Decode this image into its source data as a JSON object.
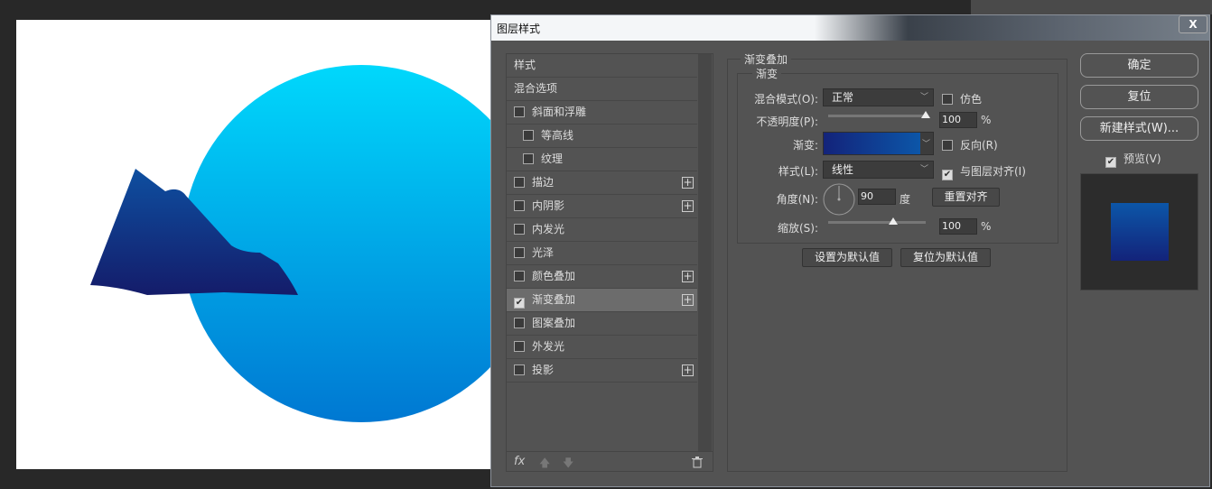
{
  "dialog": {
    "title": "图层样式",
    "close_label": "X"
  },
  "styles_list": {
    "items": [
      {
        "label": "样式",
        "checkbox": false
      },
      {
        "label": "混合选项",
        "checkbox": false
      },
      {
        "label": "斜面和浮雕",
        "checkbox": true,
        "checked": false
      },
      {
        "label": "等高线",
        "checkbox": true,
        "checked": false,
        "indent": true
      },
      {
        "label": "纹理",
        "checkbox": true,
        "checked": false,
        "indent": true
      },
      {
        "label": "描边",
        "checkbox": true,
        "checked": false,
        "plus": true
      },
      {
        "label": "内阴影",
        "checkbox": true,
        "checked": false,
        "plus": true
      },
      {
        "label": "内发光",
        "checkbox": true,
        "checked": false
      },
      {
        "label": "光泽",
        "checkbox": true,
        "checked": false
      },
      {
        "label": "颜色叠加",
        "checkbox": true,
        "checked": false,
        "plus": true
      },
      {
        "label": "渐变叠加",
        "checkbox": true,
        "checked": true,
        "plus": true,
        "selected": true
      },
      {
        "label": "图案叠加",
        "checkbox": true,
        "checked": false
      },
      {
        "label": "外发光",
        "checkbox": true,
        "checked": false
      },
      {
        "label": "投影",
        "checkbox": true,
        "checked": false,
        "plus": true
      }
    ],
    "footer": {
      "fx_label": "fx",
      "icons": [
        "fx-icon",
        "move-up-icon",
        "move-down-icon",
        "trash-icon"
      ]
    }
  },
  "gradient_overlay": {
    "section_title": "渐变叠加",
    "group_title": "渐变",
    "blend_mode_label": "混合模式(O):",
    "blend_mode_value": "正常",
    "dither_label": "仿色",
    "dither_checked": false,
    "opacity_label": "不透明度(P):",
    "opacity_value": "100",
    "opacity_unit": "%",
    "opacity_level": 100,
    "gradient_label": "渐变:",
    "gradient_colors": [
      "#13237a",
      "#0c56a8"
    ],
    "reverse_label": "反向(R)",
    "reverse_checked": false,
    "style_label": "样式(L):",
    "style_value": "线性",
    "align_label": "与图层对齐(I)",
    "align_checked": true,
    "angle_label": "角度(N):",
    "angle_value": "90",
    "angle_unit": "度",
    "reset_align_label": "重置对齐",
    "scale_label": "缩放(S):",
    "scale_value": "100",
    "scale_unit": "%",
    "scale_level": 100,
    "set_default_label": "设置为默认值",
    "reset_default_label": "复位为默认值"
  },
  "actions": {
    "ok_label": "确定",
    "reset_label": "复位",
    "new_style_label": "新建样式(W)...",
    "preview_label": "预览(V)",
    "preview_checked": true
  },
  "colors": {
    "circle_top": "#00d8fc",
    "circle_bottom": "#0078d2",
    "mountain_top": "#0e4fa0",
    "mountain_bottom": "#141c6a",
    "panel": "#535353"
  }
}
